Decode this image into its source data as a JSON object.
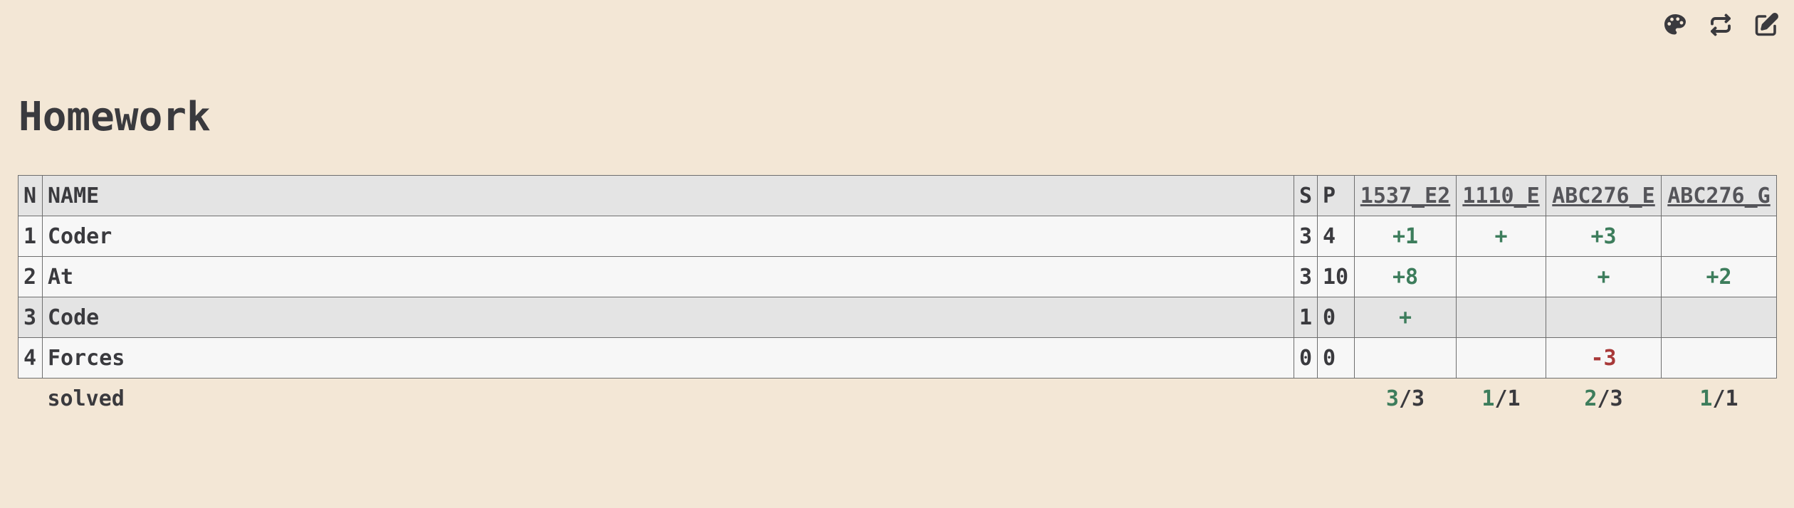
{
  "toolbar": {
    "icons": [
      "palette-icon",
      "refresh-icon",
      "edit-icon"
    ]
  },
  "page": {
    "title": "Homework"
  },
  "table": {
    "headers": {
      "n": "N",
      "name": "NAME",
      "s": "S",
      "p": "P"
    },
    "problems": [
      "1537_E2",
      "1110_E",
      "ABC276_E",
      "ABC276_G"
    ],
    "rows": [
      {
        "n": "1",
        "name": "Coder",
        "s": "3",
        "p": "4",
        "results": [
          "+1",
          "+",
          "+3",
          ""
        ]
      },
      {
        "n": "2",
        "name": "At",
        "s": "3",
        "p": "10",
        "results": [
          "+8",
          "",
          "+",
          "+2"
        ]
      },
      {
        "n": "3",
        "name": "Code",
        "s": "1",
        "p": "0",
        "results": [
          "+",
          "",
          "",
          ""
        ]
      },
      {
        "n": "4",
        "name": "Forces",
        "s": "0",
        "p": "0",
        "results": [
          "",
          "",
          "-3",
          ""
        ]
      }
    ],
    "footer": {
      "label": "solved",
      "solved": [
        {
          "ok": "3",
          "total": "/3"
        },
        {
          "ok": "1",
          "total": "/1"
        },
        {
          "ok": "2",
          "total": "/3"
        },
        {
          "ok": "1",
          "total": "/1"
        }
      ]
    }
  },
  "colors": {
    "background": "#f3e7d6",
    "accepted": "#3d7d5c",
    "rejected": "#a83838",
    "highlight_row": "#e4e4e4"
  }
}
